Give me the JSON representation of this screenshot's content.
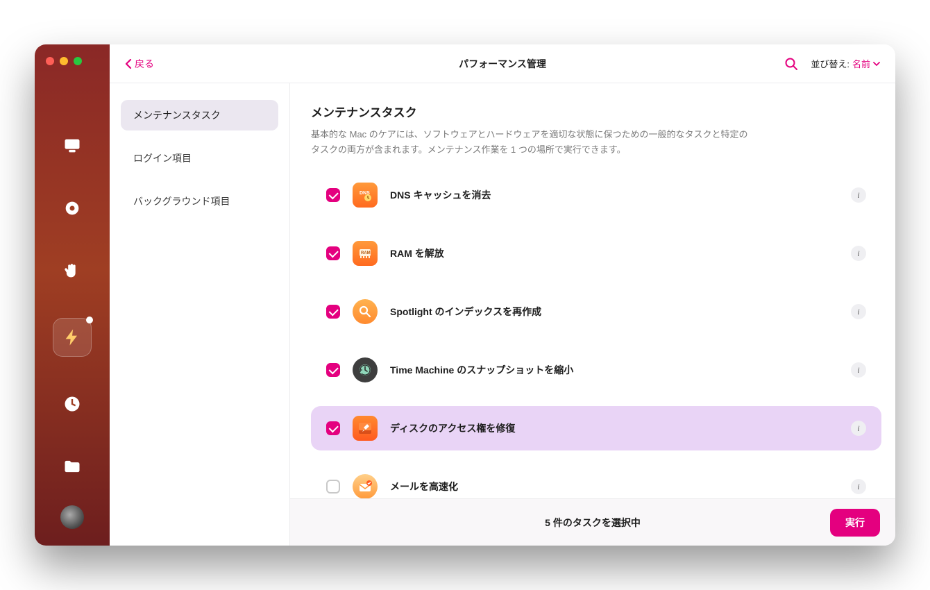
{
  "topbar": {
    "back": "戻る",
    "title": "パフォーマンス管理",
    "sort_label": "並び替え:",
    "sort_value": "名前"
  },
  "subnav": [
    {
      "label": "メンテナンスタスク",
      "active": true
    },
    {
      "label": "ログイン項目",
      "active": false
    },
    {
      "label": "バックグラウンド項目",
      "active": false
    }
  ],
  "content": {
    "heading": "メンテナンスタスク",
    "description": "基本的な Mac のケアには、ソフトウェアとハードウェアを適切な状態に保つための一般的なタスクと特定のタスクの両方が含まれます。メンテナンス作業を 1 つの場所で実行できます。"
  },
  "tasks": [
    {
      "name": "DNS キャッシュを消去",
      "checked": true,
      "icon": "dns",
      "highlight": false
    },
    {
      "name": "RAM を解放",
      "checked": true,
      "icon": "ram",
      "highlight": false
    },
    {
      "name": "Spotlight のインデックスを再作成",
      "checked": true,
      "icon": "spotlight",
      "highlight": false
    },
    {
      "name": "Time Machine のスナップショットを縮小",
      "checked": true,
      "icon": "timemachine",
      "highlight": false
    },
    {
      "name": "ディスクのアクセス権を修復",
      "checked": true,
      "icon": "disk",
      "highlight": true
    },
    {
      "name": "メールを高速化",
      "checked": false,
      "icon": "mail",
      "highlight": false
    }
  ],
  "footer": {
    "status": "5 件のタスクを選択中",
    "run": "実行"
  }
}
